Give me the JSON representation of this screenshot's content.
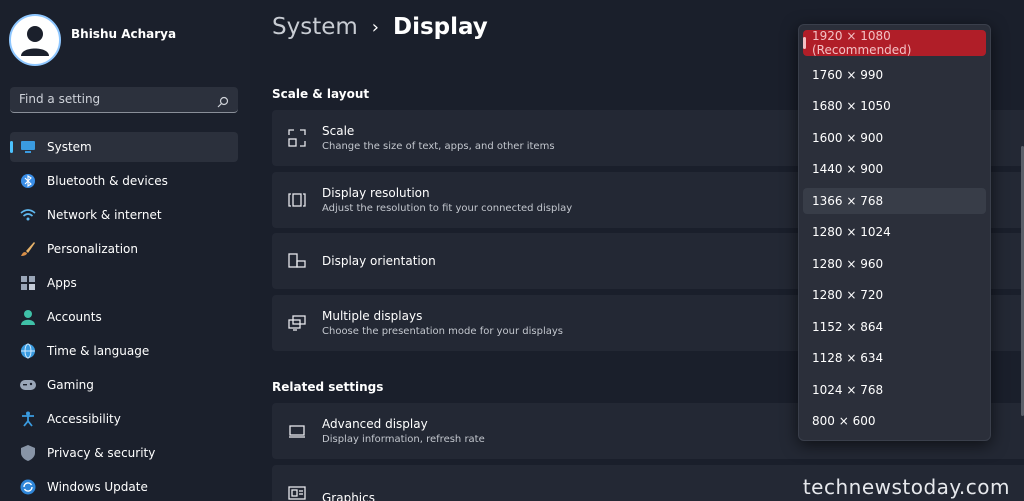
{
  "profile": {
    "name": "Bhishu Acharya"
  },
  "search": {
    "placeholder": "Find a setting"
  },
  "sidebar": {
    "items": [
      {
        "label": "System",
        "icon": "monitor-icon",
        "active": true
      },
      {
        "label": "Bluetooth & devices",
        "icon": "bluetooth-icon"
      },
      {
        "label": "Network & internet",
        "icon": "wifi-icon"
      },
      {
        "label": "Personalization",
        "icon": "brush-icon"
      },
      {
        "label": "Apps",
        "icon": "apps-icon"
      },
      {
        "label": "Accounts",
        "icon": "person-icon"
      },
      {
        "label": "Time & language",
        "icon": "globe-icon"
      },
      {
        "label": "Gaming",
        "icon": "gamepad-icon"
      },
      {
        "label": "Accessibility",
        "icon": "accessibility-icon"
      },
      {
        "label": "Privacy & security",
        "icon": "shield-icon"
      },
      {
        "label": "Windows Update",
        "icon": "update-icon"
      }
    ]
  },
  "breadcrumb": {
    "parent": "System",
    "separator": "›",
    "current": "Display"
  },
  "sections": {
    "scale_layout": "Scale & layout",
    "related": "Related settings"
  },
  "cards": [
    {
      "title": "Scale",
      "subtitle": "Change the size of text, apps, and other items",
      "icon": "scale-icon"
    },
    {
      "title": "Display resolution",
      "subtitle": "Adjust the resolution to fit your connected display",
      "icon": "resolution-icon"
    },
    {
      "title": "Display orientation",
      "subtitle": "",
      "icon": "orientation-icon"
    },
    {
      "title": "Multiple displays",
      "subtitle": "Choose the presentation mode for your displays",
      "icon": "multiple-displays-icon"
    },
    {
      "title": "Advanced display",
      "subtitle": "Display information, refresh rate",
      "icon": "advanced-display-icon"
    },
    {
      "title": "Graphics",
      "subtitle": "",
      "icon": "graphics-icon"
    }
  ],
  "resolution_options": [
    "1920 × 1080 (Recommended)",
    "1760 × 990",
    "1680 × 1050",
    "1600 × 900",
    "1440 × 900",
    "1366 × 768",
    "1280 × 1024",
    "1280 × 960",
    "1280 × 720",
    "1152 × 864",
    "1128 × 634",
    "1024 × 768",
    "800 × 600"
  ],
  "watermark": "technewstoday.com",
  "colors": {
    "accent": "#4cc2ff",
    "selected": "#b01e28"
  }
}
